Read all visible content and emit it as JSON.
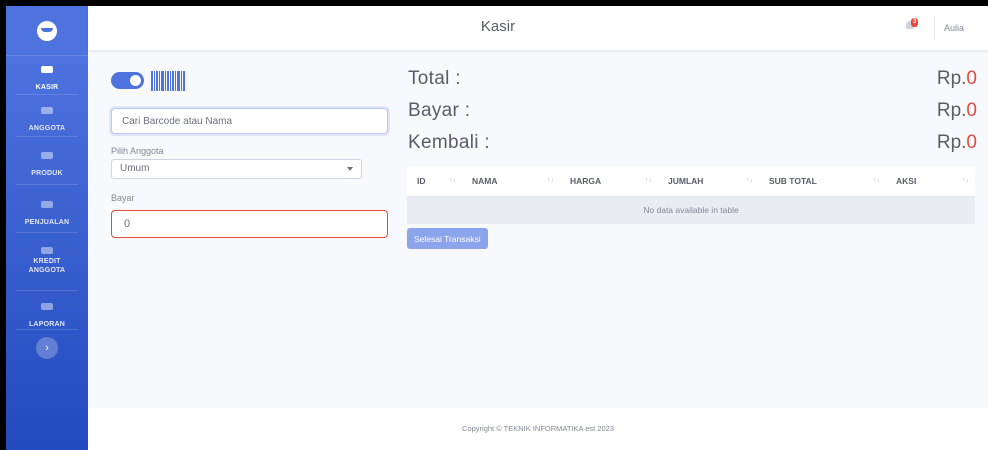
{
  "app": {
    "title": "Kasir",
    "user_name": "Aulia",
    "notification_count": "3"
  },
  "sidebar": {
    "items": [
      {
        "label": "KASIR",
        "active": true
      },
      {
        "label": "ANGGOTA",
        "active": false
      },
      {
        "label": "PRODUK",
        "active": false
      },
      {
        "label": "PENJUALAN",
        "active": false
      },
      {
        "label": "KREDIT ANGGOTA",
        "active": false
      },
      {
        "label": "LAPORAN",
        "active": false
      }
    ],
    "toggle_glyph": "›"
  },
  "form": {
    "search_placeholder": "Cari Barcode atau Nama",
    "member_label": "Pilih Anggota",
    "member_selected": "Umum",
    "pay_label": "Bayar",
    "pay_value": "0"
  },
  "summary": {
    "total_label": "Total :",
    "pay_label": "Bayar :",
    "change_label": "Kembali :",
    "currency": "Rp.",
    "total_value": "0",
    "pay_value": "0",
    "change_value": "0"
  },
  "table": {
    "columns": [
      "ID",
      "NAMA",
      "HARGA",
      "JUMLAH",
      "SUB TOTAL",
      "AKSI"
    ],
    "sort_glyph": "↑↓",
    "empty_text": "No data available in table"
  },
  "actions": {
    "finish_label": "Selesai Transaksi"
  },
  "footer": {
    "copyright": "Copyright © TEKNIK INFORMATIKA est 2023"
  },
  "colors": {
    "primary": "#4e73df",
    "danger": "#e74a3b",
    "background": "#f8f9fc"
  },
  "icons": {
    "brand": "smile-icon",
    "kasir": "cash-register-icon",
    "anggota": "users-icon",
    "produk": "box-icon",
    "penjualan": "money-icon",
    "kredit": "money-icon",
    "laporan": "report-icon",
    "notification": "bell-icon"
  }
}
